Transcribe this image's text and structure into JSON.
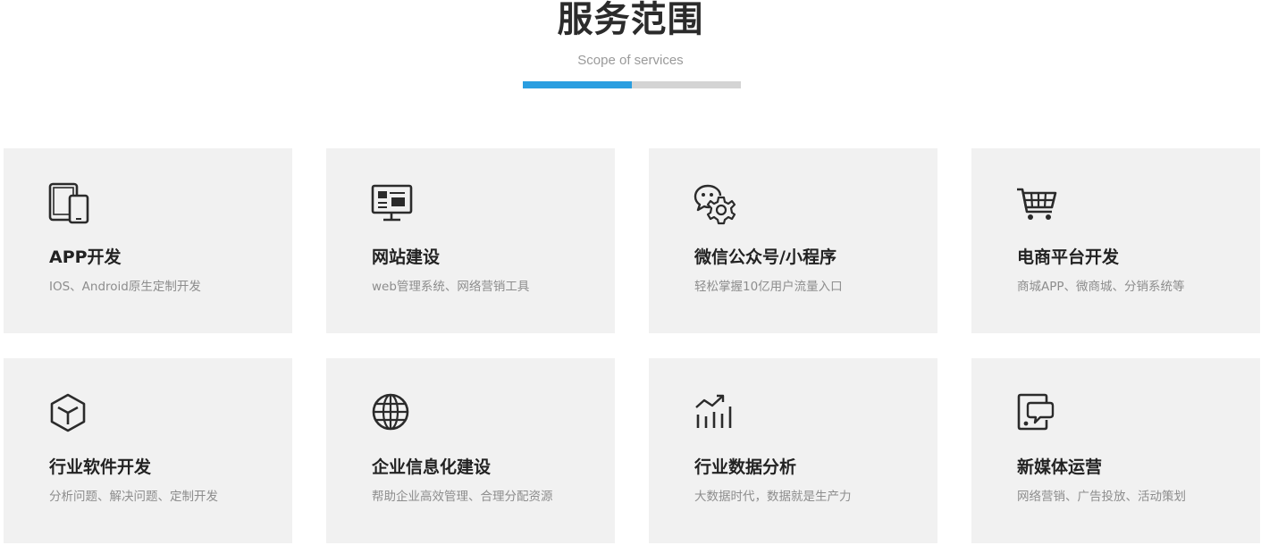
{
  "header": {
    "title": "服务范围",
    "subtitle": "Scope of services",
    "accent_color": "#2a9ee0",
    "bar_progress": 0.5
  },
  "services": [
    {
      "title": "APP开发",
      "desc": "IOS、Android原生定制开发",
      "icon": "devices-icon"
    },
    {
      "title": "网站建设",
      "desc": "web管理系统、网络营销工具",
      "icon": "monitor-icon"
    },
    {
      "title": "微信公众号/小程序",
      "desc": "轻松掌握10亿用户流量入口",
      "icon": "wechat-icon"
    },
    {
      "title": "电商平台开发",
      "desc": "商城APP、微商城、分销系统等",
      "icon": "shopping-cart-icon"
    },
    {
      "title": "行业软件开发",
      "desc": "分析问题、解决问题、定制开发",
      "icon": "cube-icon"
    },
    {
      "title": "企业信息化建设",
      "desc": "帮助企业高效管理、合理分配资源",
      "icon": "globe-icon"
    },
    {
      "title": "行业数据分析",
      "desc": "大数据时代，数据就是生产力",
      "icon": "chart-icon"
    },
    {
      "title": "新媒体运营",
      "desc": "网络营销、广告投放、活动策划",
      "icon": "media-icon"
    }
  ]
}
